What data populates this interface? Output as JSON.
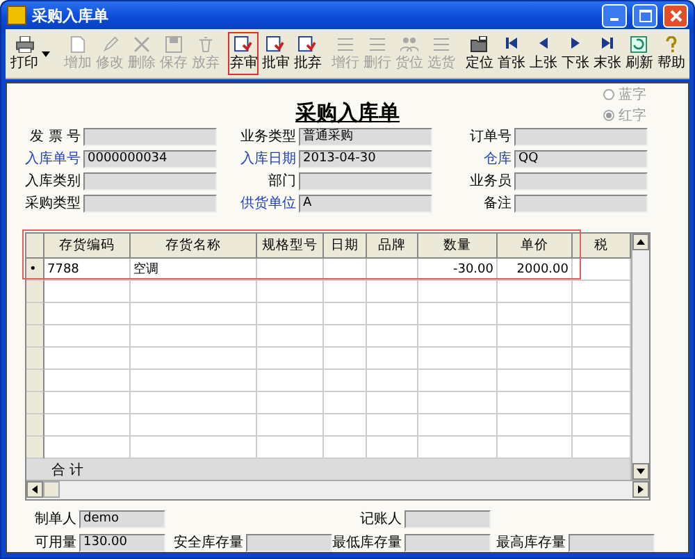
{
  "window": {
    "title": "采购入库单"
  },
  "toolbar": [
    {
      "label": "打印",
      "kind": "printer",
      "disabled": false,
      "highlighted": false,
      "dropdown": true
    },
    {
      "label": "增加",
      "kind": "doc",
      "disabled": true,
      "highlighted": false
    },
    {
      "label": "修改",
      "kind": "pencil",
      "disabled": true,
      "highlighted": false
    },
    {
      "label": "删除",
      "kind": "cross",
      "disabled": true,
      "highlighted": false
    },
    {
      "label": "保存",
      "kind": "disk",
      "disabled": true,
      "highlighted": false
    },
    {
      "label": "放弃",
      "kind": "bin",
      "disabled": true,
      "highlighted": false
    },
    {
      "label": "弃审",
      "kind": "stamp",
      "disabled": false,
      "highlighted": true
    },
    {
      "label": "批审",
      "kind": "stamp",
      "disabled": false,
      "highlighted": false
    },
    {
      "label": "批弃",
      "kind": "stamp",
      "disabled": false,
      "highlighted": false
    },
    {
      "label": "增行",
      "kind": "rows",
      "disabled": true,
      "highlighted": false
    },
    {
      "label": "删行",
      "kind": "rows",
      "disabled": true,
      "highlighted": false
    },
    {
      "label": "货位",
      "kind": "people",
      "disabled": true,
      "highlighted": false
    },
    {
      "label": "选货",
      "kind": "rows",
      "disabled": true,
      "highlighted": false
    },
    {
      "label": "定位",
      "kind": "locate",
      "disabled": false,
      "highlighted": false
    },
    {
      "label": "首张",
      "kind": "first",
      "disabled": false,
      "highlighted": false
    },
    {
      "label": "上张",
      "kind": "prev",
      "disabled": false,
      "highlighted": false
    },
    {
      "label": "下张",
      "kind": "next",
      "disabled": false,
      "highlighted": false
    },
    {
      "label": "末张",
      "kind": "last",
      "disabled": false,
      "highlighted": false
    },
    {
      "label": "刷新",
      "kind": "refresh",
      "disabled": false,
      "highlighted": false
    },
    {
      "label": "帮助",
      "kind": "help",
      "disabled": false,
      "highlighted": false
    }
  ],
  "form": {
    "title": "采购入库单",
    "radios": [
      {
        "label": "蓝字",
        "selected": false
      },
      {
        "label": "红字",
        "selected": true
      }
    ],
    "fields": [
      {
        "label": "发 票 号",
        "required": false
      },
      {
        "label": "业务类型",
        "value": "普通采购",
        "required": false
      },
      {
        "label": "订单号",
        "required": false
      },
      {
        "label": "入库单号",
        "value": "0000000034",
        "required": true
      },
      {
        "label": "入库日期",
        "value": "2013-04-30",
        "required": true
      },
      {
        "label": "仓库",
        "value": "QQ",
        "required": true
      },
      {
        "label": "入库类别",
        "required": false
      },
      {
        "label": "部门",
        "required": false
      },
      {
        "label": "业务员",
        "required": false
      },
      {
        "label": "采购类型",
        "required": false
      },
      {
        "label": "供货单位",
        "value": "A",
        "required": true
      },
      {
        "label": "备注",
        "required": false
      }
    ]
  },
  "grid": {
    "highlighted": true,
    "columns": [
      "",
      "存货编码",
      "存货名称",
      "规格型号",
      "日期",
      "品牌",
      "数量",
      "单价",
      "税"
    ],
    "rows": [
      {
        "current": true,
        "cells": [
          "•",
          "7788",
          "空调",
          "",
          "",
          "",
          "-30.00",
          "2000.00",
          ""
        ]
      }
    ],
    "total_label": "合 计"
  },
  "footer": {
    "fields": [
      {
        "label": "制单人",
        "value": "demo"
      },
      {
        "label": "记账人"
      },
      {
        "label": "可用量",
        "value": "130.00"
      },
      {
        "label": "安全库存量"
      },
      {
        "label": "最低库存量"
      },
      {
        "label": "最高库存量"
      }
    ]
  }
}
